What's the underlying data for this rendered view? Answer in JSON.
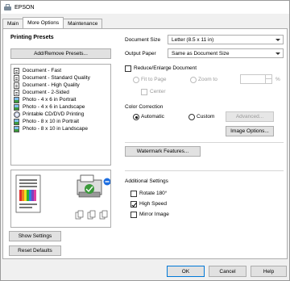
{
  "window": {
    "title": "EPSON"
  },
  "tabs": [
    "Main",
    "More Options",
    "Maintenance"
  ],
  "left": {
    "printing_presets": "Printing Presets",
    "add_remove_label": "Add/Remove Presets...",
    "presets": [
      {
        "label": "Document - Fast",
        "icon": "document-icon"
      },
      {
        "label": "Document - Standard Quality",
        "icon": "document-icon"
      },
      {
        "label": "Document - High Quality",
        "icon": "document-icon"
      },
      {
        "label": "Document - 2-Sided",
        "icon": "document-icon"
      },
      {
        "label": "Photo - 4 x 6 in Portrait",
        "icon": "photo-icon"
      },
      {
        "label": "Photo - 4 x 6 in Landscape",
        "icon": "photo-icon"
      },
      {
        "label": "Printable CD/DVD Printing",
        "icon": "cd-icon"
      },
      {
        "label": "Photo - 8 x 10 in Portrait",
        "icon": "photo-icon"
      },
      {
        "label": "Photo - 8 x 10 in Landscape",
        "icon": "photo-icon"
      }
    ],
    "show_settings": "Show Settings",
    "reset_defaults": "Reset Defaults"
  },
  "right": {
    "document_size_label": "Document Size",
    "document_size_value": "Letter (8.5 x 11 in)",
    "output_paper_label": "Output Paper",
    "output_paper_value": "Same as Document Size",
    "reduce_enlarge_label": "Reduce/Enlarge Document",
    "fit_to_page": "Fit to Page",
    "zoom_to": "Zoom to",
    "center": "Center",
    "percent_sign": "%",
    "color_correction_label": "Color Correction",
    "automatic": "Automatic",
    "custom": "Custom",
    "advanced": "Advanced...",
    "image_options": "Image Options...",
    "watermark_features": "Watermark Features...",
    "additional_settings_label": "Additional Settings",
    "rotate_180": "Rotate 180°",
    "high_speed": "High Speed",
    "mirror_image": "Mirror Image"
  },
  "footer": {
    "ok": "OK",
    "cancel": "Cancel",
    "help": "Help"
  },
  "colors": {
    "accent": "#0078d7",
    "border": "#adadad",
    "disabled": "#9a9a9a"
  }
}
